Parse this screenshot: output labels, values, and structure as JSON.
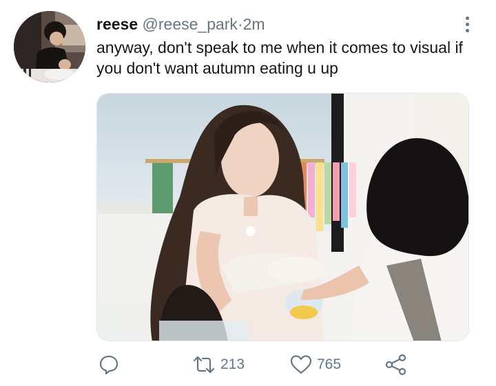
{
  "tweet": {
    "display_name": "reese",
    "handle": "@reese_park",
    "separator": "·",
    "time": "2m",
    "text": "anyway, don't speak to me when it comes to visual if you don't want autumn eating u up"
  },
  "actions": {
    "reply_count": "",
    "retweet_count": "213",
    "like_count": "765"
  },
  "icons": {
    "more": "more-vertical-icon",
    "reply": "reply-icon",
    "retweet": "retweet-icon",
    "like": "heart-icon",
    "share": "share-icon"
  },
  "colors": {
    "text": "#14171a",
    "muted": "#657786",
    "border": "#e1e8ed"
  }
}
